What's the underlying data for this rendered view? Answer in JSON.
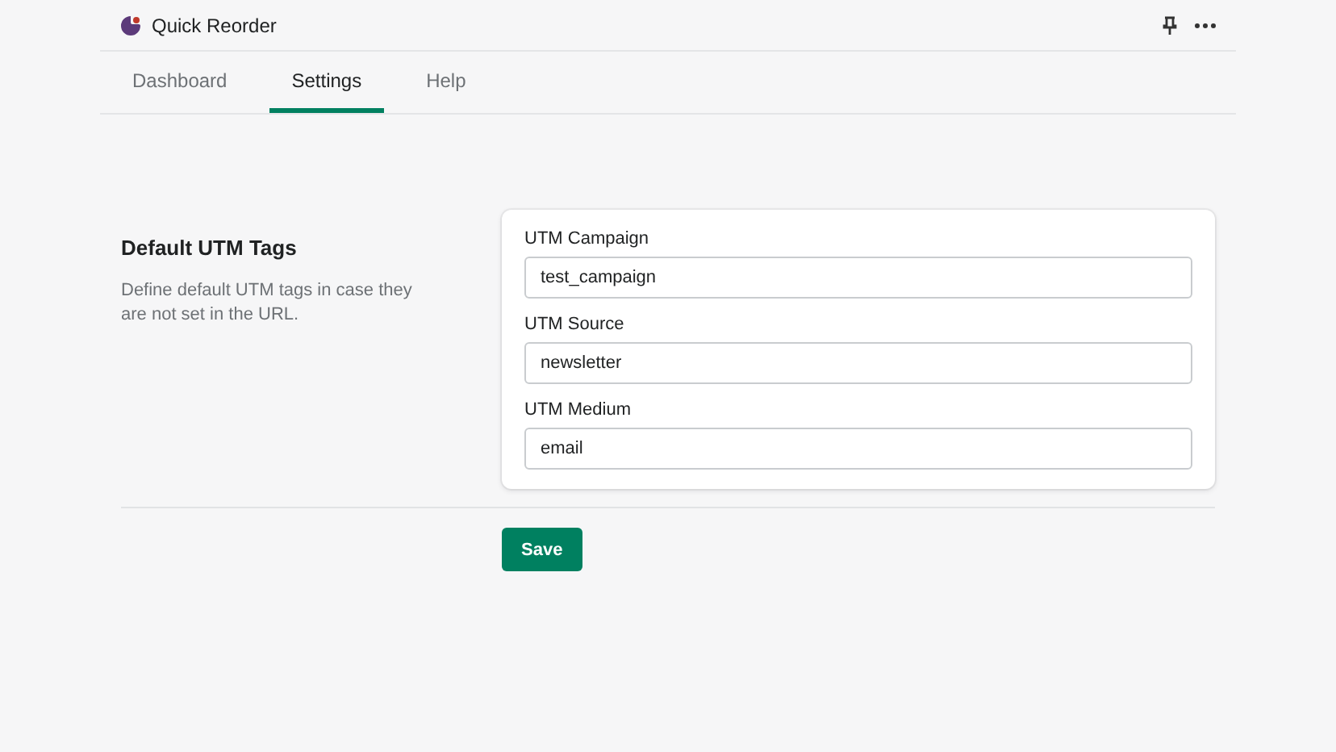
{
  "app": {
    "title": "Quick Reorder"
  },
  "tabs": [
    {
      "label": "Dashboard",
      "selected": false
    },
    {
      "label": "Settings",
      "selected": true
    },
    {
      "label": "Help",
      "selected": false
    }
  ],
  "section": {
    "title": "Default UTM Tags",
    "description": "Define default UTM tags in case they are not set in the URL."
  },
  "fields": [
    {
      "label": "UTM Campaign",
      "value": "test_campaign"
    },
    {
      "label": "UTM Source",
      "value": "newsletter"
    },
    {
      "label": "UTM Medium",
      "value": "email"
    }
  ],
  "save_button": "Save"
}
